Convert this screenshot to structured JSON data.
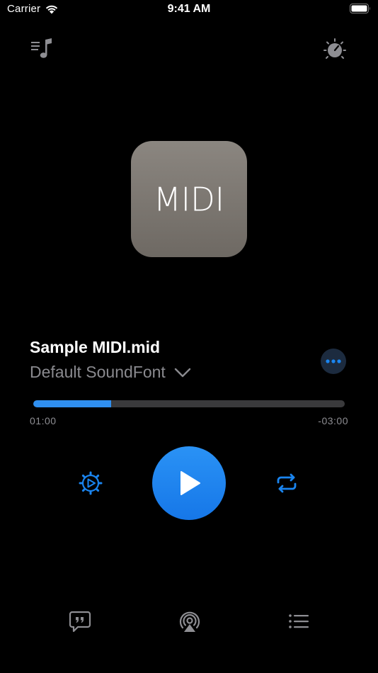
{
  "status_bar": {
    "carrier": "Carrier",
    "time": "9:41 AM"
  },
  "header": {
    "left_icon": "music-playlist-icon",
    "right_icon": "knob-settings-icon"
  },
  "artwork": {
    "label": "MIDI"
  },
  "track": {
    "title": "Sample MIDI.mid",
    "soundfont": "Default SoundFont",
    "more_icon": "ellipsis-icon"
  },
  "progress": {
    "elapsed": "01:00",
    "remaining": "-03:00",
    "fraction": 0.25
  },
  "controls": {
    "left_icon": "play-gear-icon",
    "center_icon": "play-icon",
    "right_icon": "repeat-icon"
  },
  "bottom_bar": {
    "items": [
      "lyrics-quote-icon",
      "airplay-icon",
      "list-icon"
    ]
  },
  "colors": {
    "accent": "#1a85f0",
    "background": "#000000",
    "secondary_text": "#8a8a8f"
  }
}
